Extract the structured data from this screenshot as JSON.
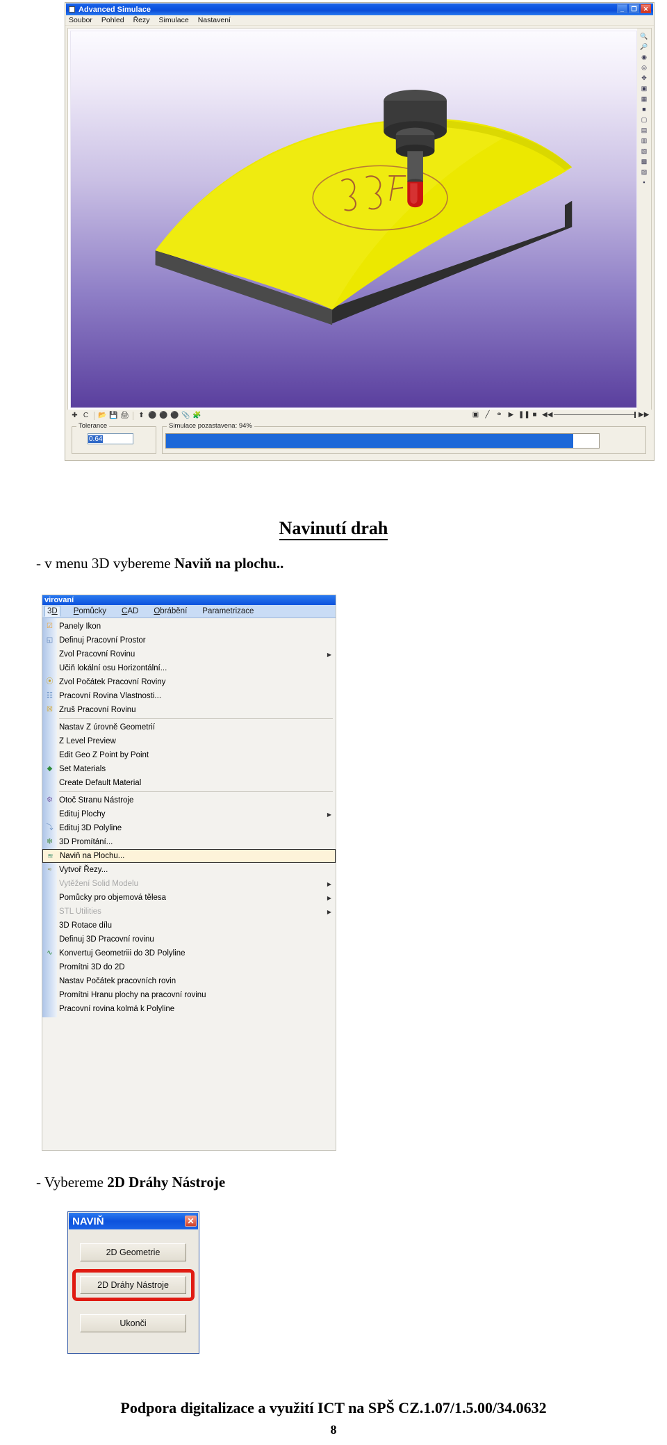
{
  "sim_window": {
    "title": "Advanced Simulace",
    "window_buttons": [
      "_",
      "❐",
      "✕"
    ],
    "menus": [
      "Soubor",
      "Pohled",
      "Řezy",
      "Simulace",
      "Nastavení"
    ],
    "right_toolbar_icons": [
      "zoom-icon",
      "zoom-out-icon",
      "zoom-in-icon",
      "zoom-window-icon",
      "pan-icon",
      "fit-icon",
      "view-iso-icon",
      "view-front-icon",
      "view-top-icon",
      "view-right-icon",
      "view-back-icon",
      "view-bottom-icon",
      "view-left-icon",
      "view-shade-icon",
      "view-wire-icon"
    ],
    "bottom_toolbar_icons": [
      "crosshair-icon",
      "c-icon",
      "open-icon",
      "save-icon",
      "print-icon",
      "up-arrow-icon",
      "stock-icon",
      "stock2-icon",
      "stock3-icon",
      "attach-icon",
      "material-icon"
    ],
    "playback_icons": [
      "render-icon",
      "tool-icon",
      "probe-icon",
      "play-icon",
      "pause-icon",
      "stop-icon",
      "rewind-icon",
      "fastforward-icon"
    ],
    "tolerance": {
      "label": "Tolerance",
      "value": "0.64"
    },
    "progress": {
      "label": "Simulace pozastavena: 94%",
      "percent": 94
    }
  },
  "document": {
    "heading": "Navinutí drah",
    "line1_plain": "- v menu 3D vybereme ",
    "line1_bold": "Naviň na plochu..",
    "line2_plain": "- Vybereme ",
    "line2_bold": "2D Dráhy Nástroje",
    "footer": "Podpora digitalizace a využití ICT na SPŠ  CZ.1.07/1.5.00/34.0632",
    "page_number": "8"
  },
  "menu_shot": {
    "caption": "virovaní",
    "tabs": [
      {
        "label": "3D",
        "active": true
      },
      {
        "label": "Pomůcky",
        "active": false
      },
      {
        "label": "CAD",
        "active": false
      },
      {
        "label": "Obrábění",
        "active": false
      },
      {
        "label": "Parametrizace",
        "active": false
      }
    ],
    "items": [
      {
        "label": "Panely Ikon",
        "icon": "checkbox-checked-icon",
        "submenu": false,
        "disabled": false,
        "highlight": false,
        "sep_after": false
      },
      {
        "label": "Definuj Pracovní Prostor",
        "icon": "workspace-box-icon",
        "submenu": false,
        "disabled": false,
        "highlight": false,
        "sep_after": false
      },
      {
        "label": "Zvol Pracovní Rovinu",
        "icon": "",
        "submenu": true,
        "disabled": false,
        "highlight": false,
        "sep_after": false
      },
      {
        "label": "Učiň lokální osu Horizontální...",
        "icon": "",
        "submenu": false,
        "disabled": false,
        "highlight": false,
        "sep_after": false
      },
      {
        "label": "Zvol Počátek Pracovní Roviny",
        "icon": "origin-icon",
        "submenu": false,
        "disabled": false,
        "highlight": false,
        "sep_after": false
      },
      {
        "label": "Pracovní Rovina Vlastnosti...",
        "icon": "properties-icon",
        "submenu": false,
        "disabled": false,
        "highlight": false,
        "sep_after": false
      },
      {
        "label": "Zruš Pracovní Rovinu",
        "icon": "delete-plane-icon",
        "submenu": false,
        "disabled": false,
        "highlight": false,
        "sep_after": true
      },
      {
        "label": "Nastav Z úrovně Geometrií",
        "icon": "",
        "submenu": false,
        "disabled": false,
        "highlight": false,
        "sep_after": false
      },
      {
        "label": "Z Level Preview",
        "icon": "",
        "submenu": false,
        "disabled": false,
        "highlight": false,
        "sep_after": false
      },
      {
        "label": "Edit Geo Z Point by Point",
        "icon": "",
        "submenu": false,
        "disabled": false,
        "highlight": false,
        "sep_after": false
      },
      {
        "label": "Set Materials",
        "icon": "material-green-icon",
        "submenu": false,
        "disabled": false,
        "highlight": false,
        "sep_after": false
      },
      {
        "label": "Create Default Material",
        "icon": "",
        "submenu": false,
        "disabled": false,
        "highlight": false,
        "sep_after": true
      },
      {
        "label": "Otoč Stranu Nástroje",
        "icon": "flip-tool-icon",
        "submenu": false,
        "disabled": false,
        "highlight": false,
        "sep_after": false
      },
      {
        "label": "Edituj Plochy",
        "icon": "",
        "submenu": true,
        "disabled": false,
        "highlight": false,
        "sep_after": false
      },
      {
        "label": "Edituj 3D Polyline",
        "icon": "polyline-icon",
        "submenu": false,
        "disabled": false,
        "highlight": false,
        "sep_after": false
      },
      {
        "label": "3D Promítání...",
        "icon": "project-3d-icon",
        "submenu": false,
        "disabled": false,
        "highlight": false,
        "sep_after": false
      },
      {
        "label": "Naviň na Plochu...",
        "icon": "wrap-surface-icon",
        "submenu": false,
        "disabled": false,
        "highlight": true,
        "sep_after": false
      },
      {
        "label": "Vytvoř Řezy...",
        "icon": "sections-icon",
        "submenu": false,
        "disabled": false,
        "highlight": false,
        "sep_after": false
      },
      {
        "label": "Vytěžení Solid Modelu",
        "icon": "",
        "submenu": true,
        "disabled": true,
        "highlight": false,
        "sep_after": false
      },
      {
        "label": "Pomůcky pro objemová tělesa",
        "icon": "",
        "submenu": true,
        "disabled": false,
        "highlight": false,
        "sep_after": false
      },
      {
        "label": "STL Utilities",
        "icon": "",
        "submenu": true,
        "disabled": true,
        "highlight": false,
        "sep_after": false
      },
      {
        "label": "3D Rotace dílu",
        "icon": "",
        "submenu": false,
        "disabled": false,
        "highlight": false,
        "sep_after": false
      },
      {
        "label": "Definuj 3D Pracovní rovinu",
        "icon": "",
        "submenu": false,
        "disabled": false,
        "highlight": false,
        "sep_after": false
      },
      {
        "label": "Konvertuj Geometriii do 3D Polyline",
        "icon": "convert-polyline-icon",
        "submenu": false,
        "disabled": false,
        "highlight": false,
        "sep_after": false
      },
      {
        "label": "Promítni 3D do 2D",
        "icon": "",
        "submenu": false,
        "disabled": false,
        "highlight": false,
        "sep_after": false
      },
      {
        "label": "Nastav Počátek pracovních rovin",
        "icon": "",
        "submenu": false,
        "disabled": false,
        "highlight": false,
        "sep_after": false
      },
      {
        "label": "Promítni Hranu plochy na pracovní rovinu",
        "icon": "",
        "submenu": false,
        "disabled": false,
        "highlight": false,
        "sep_after": false
      },
      {
        "label": "Pracovní rovina kolmá k Polyline",
        "icon": "",
        "submenu": false,
        "disabled": false,
        "highlight": false,
        "sep_after": false
      }
    ]
  },
  "navin_dialog": {
    "title": "NAVIŇ",
    "close_label": "✕",
    "buttons": [
      {
        "label": "2D Geometrie",
        "highlighted": false
      },
      {
        "label": "2D Dráhy Nástroje",
        "highlighted": true
      },
      {
        "label": "Ukonči",
        "highlighted": false
      }
    ]
  },
  "colors": {
    "title_blue": "#0c52dd",
    "highlight_yellow": "#fdf3d9",
    "annotation_red": "#e01b12",
    "progress_blue": "#1d68d8",
    "part_yellow": "#e8e800",
    "viewport_purple": "#5a3f9e"
  }
}
